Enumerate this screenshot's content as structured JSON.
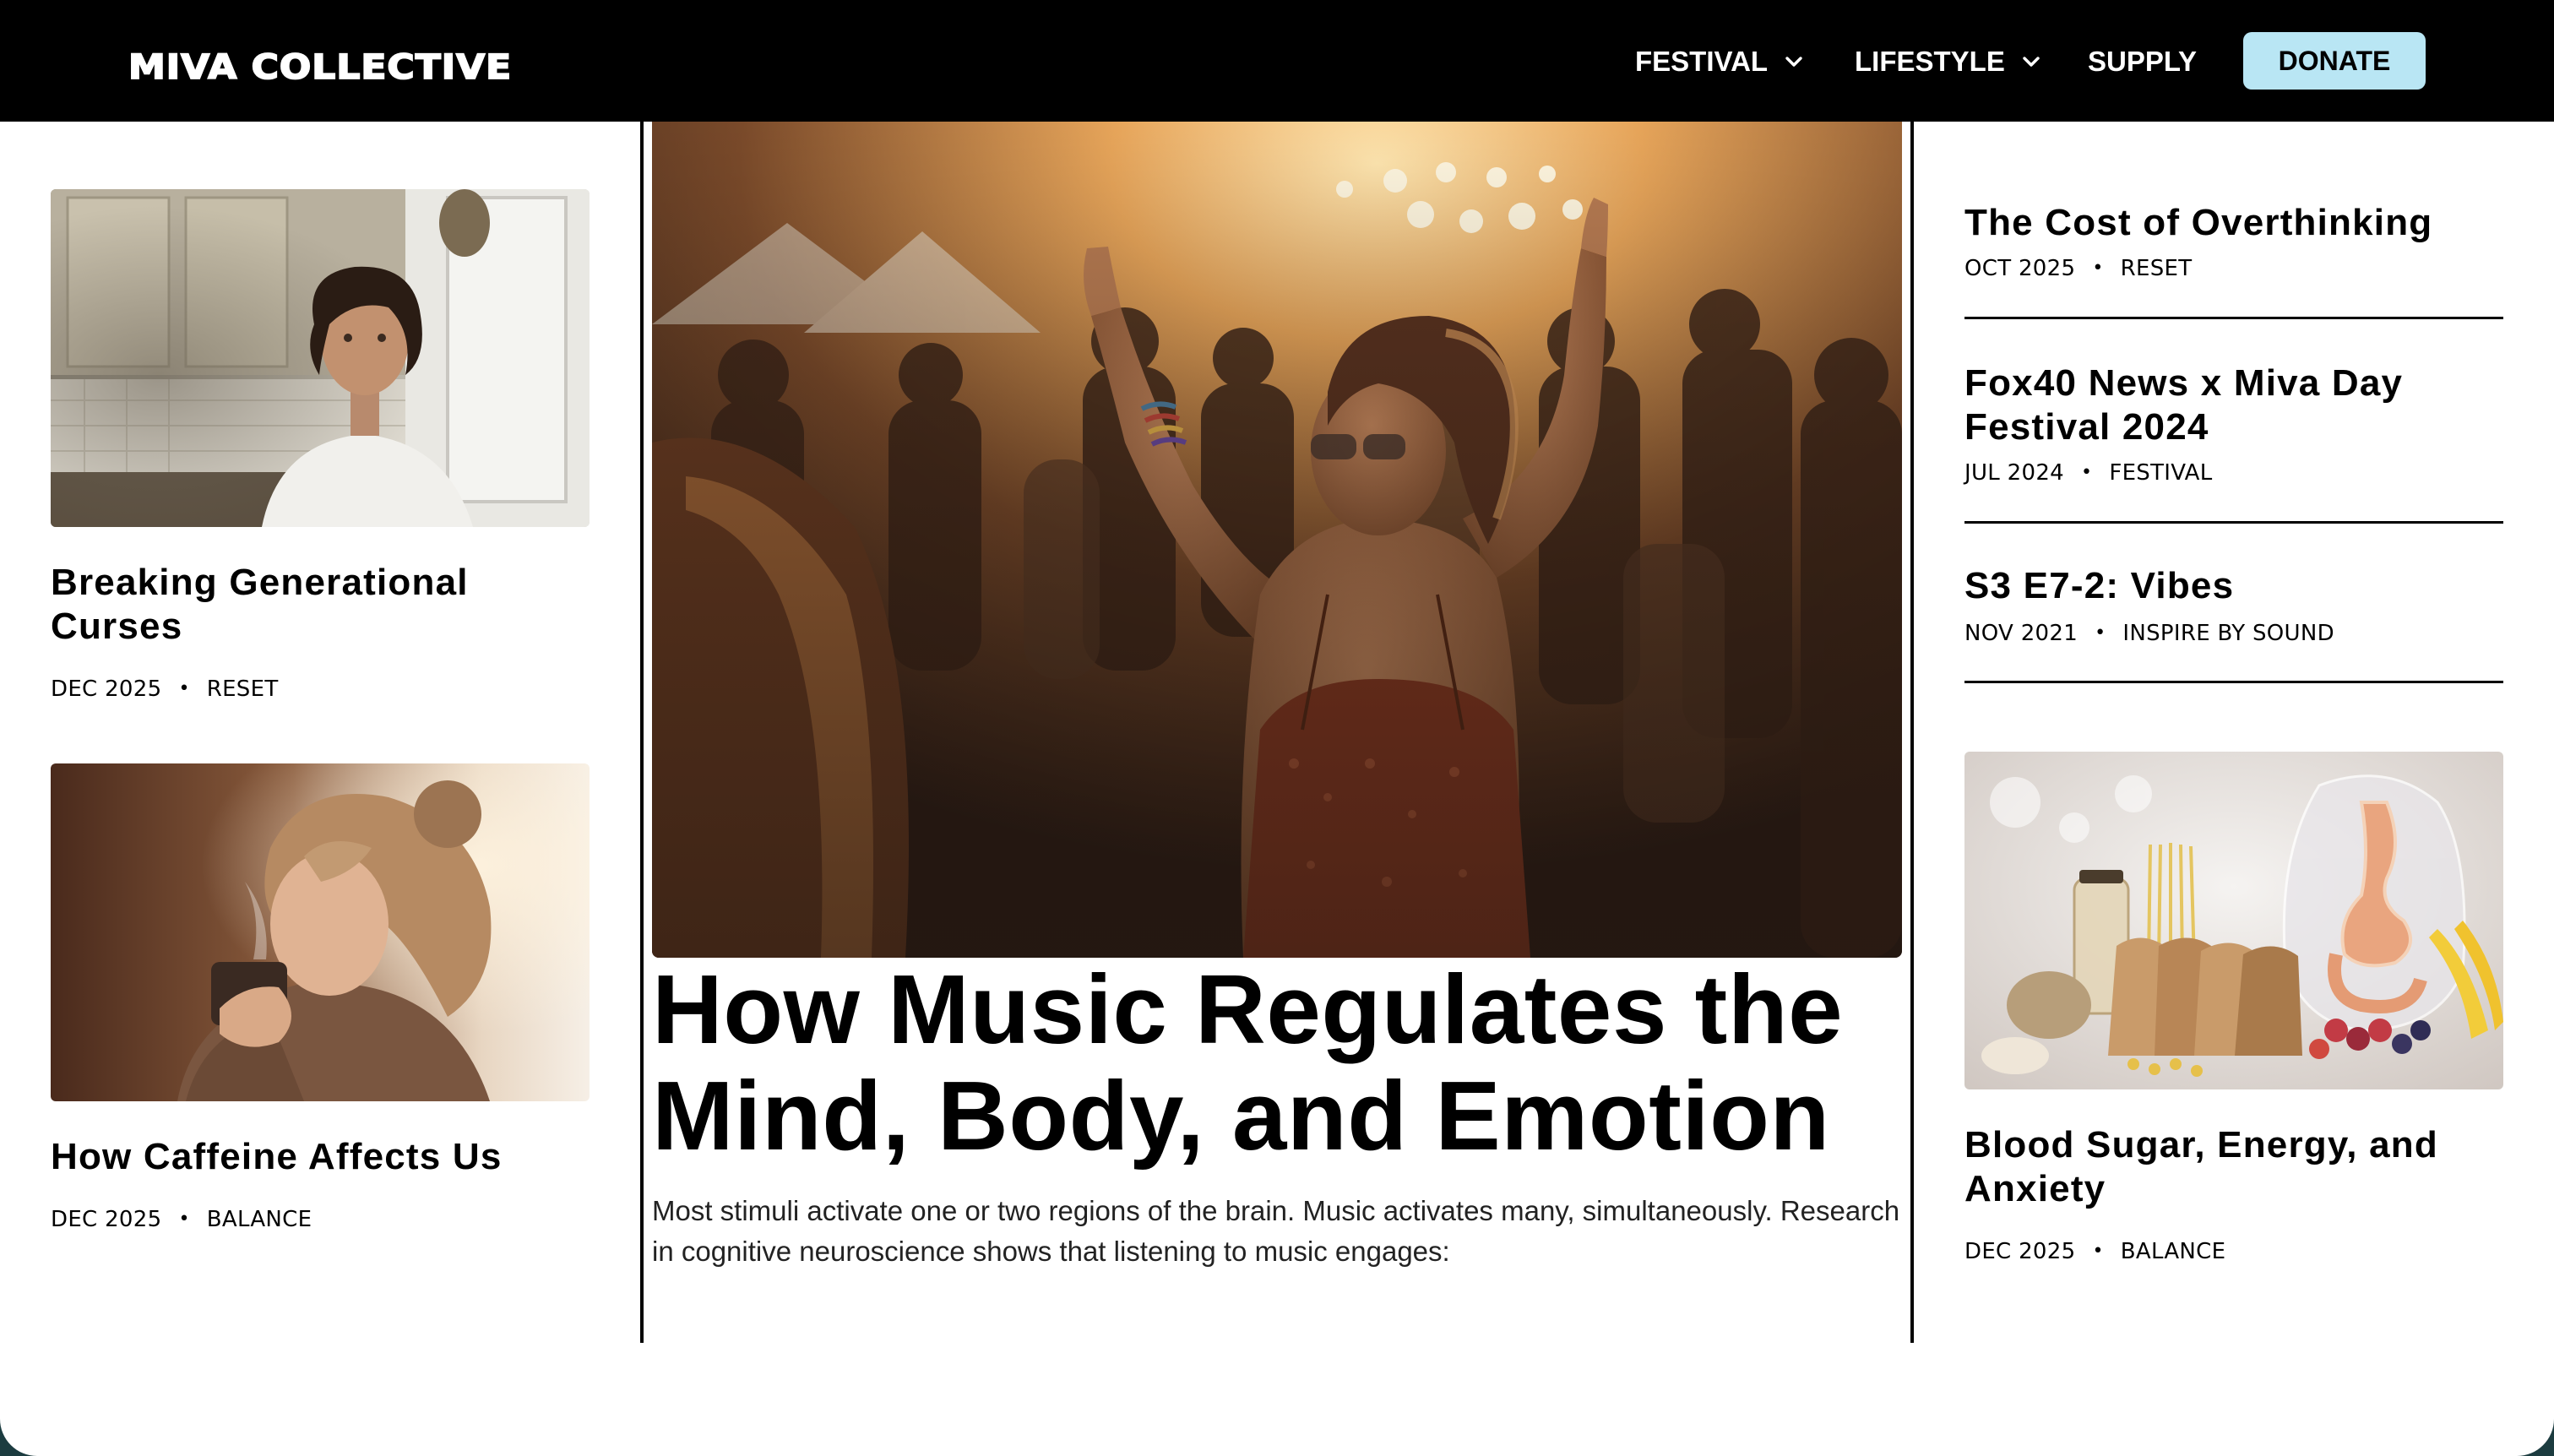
{
  "brand": {
    "logo_text": "MIVA COLLECTIVE"
  },
  "nav": {
    "items": [
      {
        "label": "FESTIVAL",
        "has_dropdown": true
      },
      {
        "label": "LIFESTYLE",
        "has_dropdown": true
      },
      {
        "label": "SUPPLY",
        "has_dropdown": false
      }
    ],
    "donate_label": "DONATE"
  },
  "colors": {
    "header_bg": "#000000",
    "donate_bg": "#b9e6f4",
    "page_bg": "#ffffff",
    "text": "#000000"
  },
  "left_column": {
    "articles": [
      {
        "title": "Breaking Generational Curses",
        "date": "DEC 2025",
        "category": "RESET",
        "image": "woman-in-kitchen-photo"
      },
      {
        "title": "How Caffeine Affects Us",
        "date": "DEC 2025",
        "category": "BALANCE",
        "image": "woman-drinking-coffee-photo"
      }
    ]
  },
  "feature": {
    "image": "festival-crowd-dancing-photo",
    "title": "How Music Regulates the Mind, Body, and Emotion",
    "body": "Most stimuli activate one or two regions of the brain. Music activates many, simultaneously. Research in cognitive neuroscience shows that listening to music engages:"
  },
  "right_column": {
    "list": [
      {
        "title": "The Cost of Overthinking",
        "date": "OCT 2025",
        "category": "RESET"
      },
      {
        "title": "Fox40 News x Miva Day Festival 2024",
        "date": "JUL 2024",
        "category": "FESTIVAL"
      },
      {
        "title": "S3 E7-2: Vibes",
        "date": "NOV 2021",
        "category": "INSPIRE BY SOUND"
      }
    ],
    "card": {
      "title": "Blood Sugar, Energy, and Anxiety",
      "date": "DEC 2025",
      "category": "BALANCE",
      "image": "healthy-food-digestion-photo"
    }
  },
  "separator": "•"
}
